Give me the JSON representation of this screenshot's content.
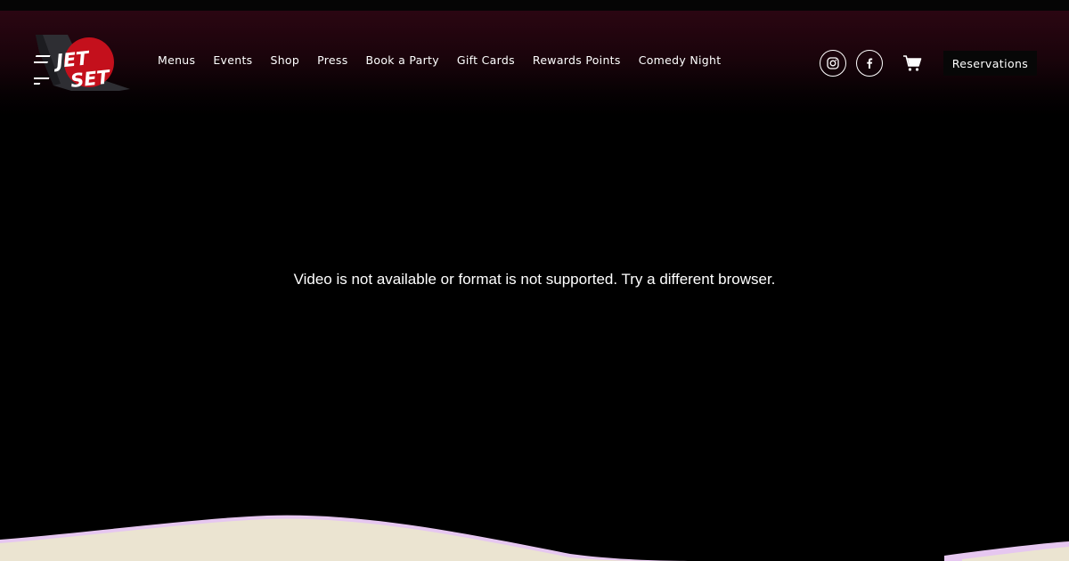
{
  "brand": {
    "logo_text_line1": "JET",
    "logo_text_line2": "SET",
    "logo_circle_color": "#c4101c"
  },
  "nav": {
    "items": [
      {
        "label": "Menus"
      },
      {
        "label": "Events"
      },
      {
        "label": "Shop"
      },
      {
        "label": "Press"
      },
      {
        "label": "Book a Party"
      },
      {
        "label": "Gift Cards"
      },
      {
        "label": "Rewards Points"
      },
      {
        "label": "Comedy Night"
      }
    ]
  },
  "header_actions": {
    "social_icons": [
      "instagram-icon",
      "facebook-icon"
    ],
    "cart_icon": "cart-icon",
    "reservations_label": "Reservations"
  },
  "video": {
    "message": "Video is not available or format is not supported. Try a different browser."
  },
  "theme": {
    "background": "#000000",
    "header_glow": "#2b0612",
    "wave_fill": "#ebe4d1",
    "wave_edge": "#e6c7f0"
  }
}
